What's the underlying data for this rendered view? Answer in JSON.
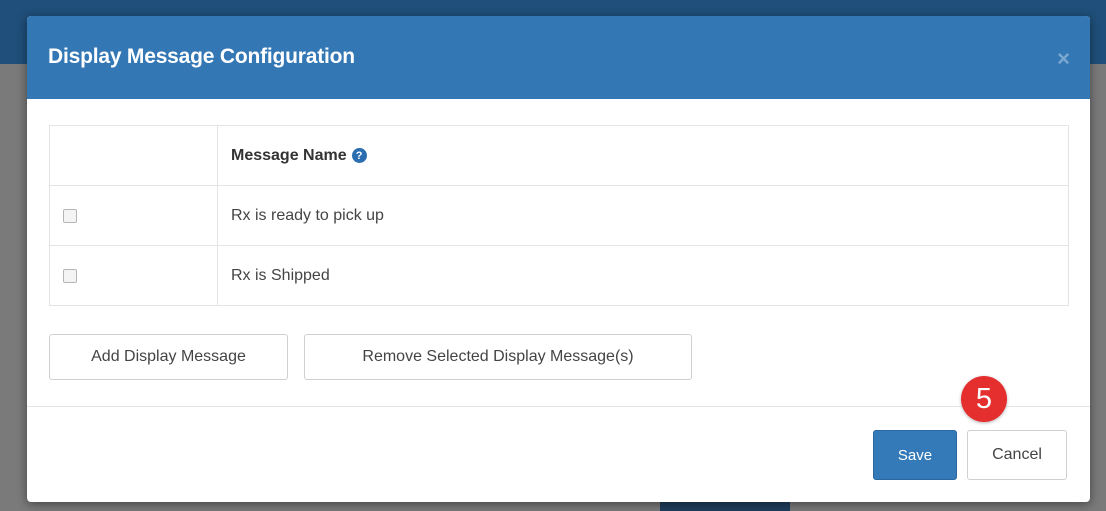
{
  "modal": {
    "title": "Display Message Configuration",
    "close_glyph": "×"
  },
  "table": {
    "header": {
      "message_name": "Message Name",
      "help_glyph": "?"
    },
    "rows": [
      {
        "message_name": "Rx is ready to pick up",
        "checked": false
      },
      {
        "message_name": "Rx is Shipped",
        "checked": false
      }
    ]
  },
  "actions": {
    "add_label": "Add Display Message",
    "remove_label": "Remove Selected Display Message(s)"
  },
  "footer": {
    "save_label": "Save",
    "cancel_label": "Cancel"
  },
  "step_badge": "5",
  "colors": {
    "header_bg": "#3477b5",
    "primary_button": "#3479b8",
    "badge": "#e52e2e"
  }
}
